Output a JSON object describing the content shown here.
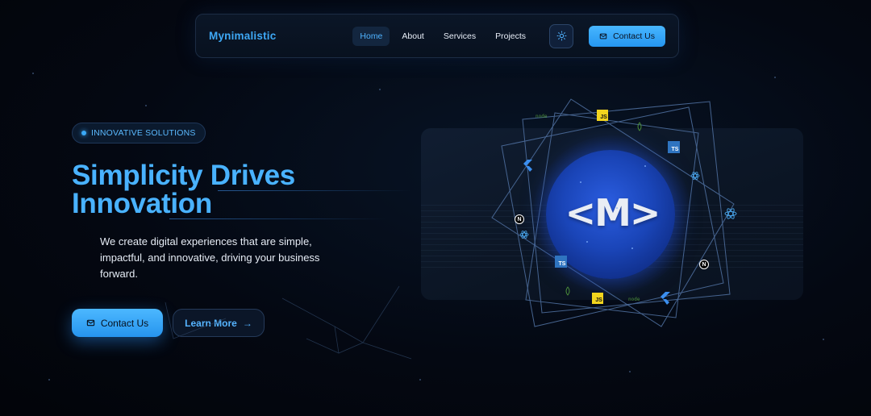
{
  "header": {
    "brand": "Mynimalistic",
    "nav": [
      {
        "label": "Home",
        "active": true
      },
      {
        "label": "About",
        "active": false
      },
      {
        "label": "Services",
        "active": false
      },
      {
        "label": "Projects",
        "active": false
      }
    ],
    "theme_icon": "sun-icon",
    "cta_label": "Contact Us",
    "cta_icon": "mail-icon"
  },
  "hero": {
    "badge": "INNOVATIVE SOLUTIONS",
    "title_line1": "Simplicity Drives",
    "title_line2": "Innovation",
    "description": "We create digital experiences that are simple, impactful, and innovative, driving your business forward.",
    "primary_button": "Contact Us",
    "secondary_button": "Learn More",
    "secondary_arrow": "→"
  },
  "illustration": {
    "logo_text": "<M>",
    "tech_labels": {
      "js": "JS",
      "ts": "TS",
      "next": "N",
      "node": "node"
    }
  },
  "colors": {
    "accent": "#49b2ff",
    "background": "#040812",
    "orb": "#1a45b8"
  }
}
